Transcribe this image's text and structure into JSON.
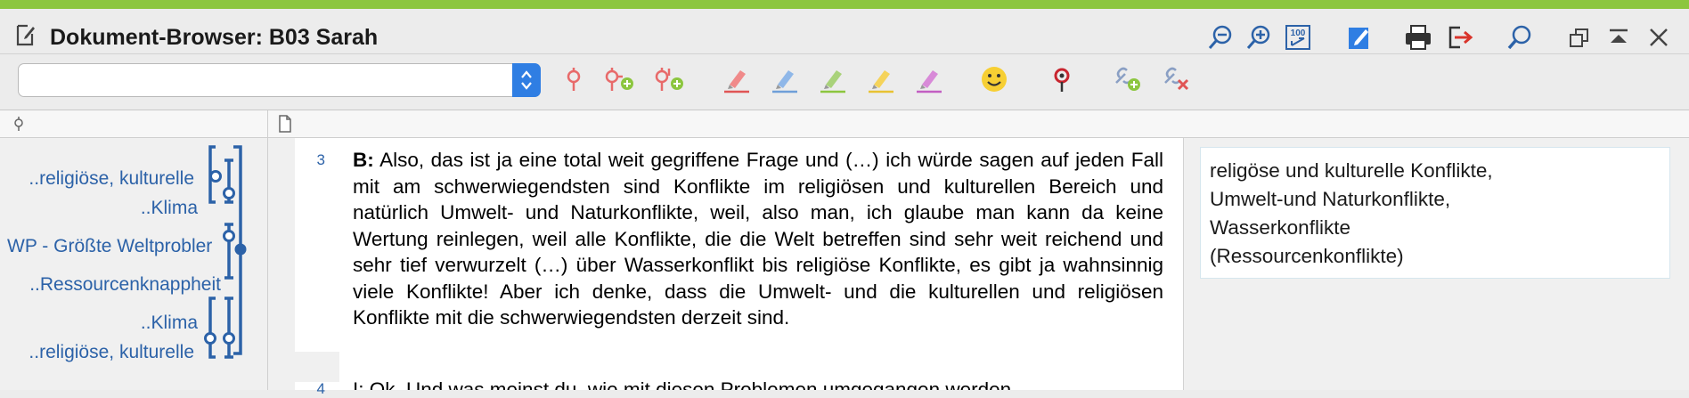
{
  "window": {
    "title": "Dokument-Browser: B03 Sarah",
    "accent_color": "#8cc63f",
    "title_icons": [
      "zoom-out-icon",
      "zoom-in-icon",
      "zoom-100-icon",
      "edit-icon",
      "print-icon",
      "export-icon",
      "search-icon",
      "restore-icon",
      "collapse-icon",
      "close-icon"
    ]
  },
  "toolbar": {
    "combo_value": "",
    "tool_icons": [
      "code-icon",
      "new-code-icon",
      "in-vivo-code-icon",
      "highlight-red-icon",
      "highlight-blue-icon",
      "highlight-green-icon",
      "highlight-yellow-icon",
      "highlight-magenta-icon",
      "emoticode-icon",
      "memo-pin-icon",
      "link-add-icon",
      "link-remove-icon"
    ]
  },
  "codes": [
    {
      "label": "..religiöse, kulturelle"
    },
    {
      "label": "..Klima"
    },
    {
      "label": "WP - Größte Weltprobler"
    },
    {
      "label": "..Ressourcenknappheit"
    },
    {
      "label": "..Klima"
    },
    {
      "label": "..religiöse, kulturelle"
    }
  ],
  "paragraph": {
    "line_number": "3",
    "speaker": "B:",
    "text": " Also, das ist ja eine total weit gegriffene Frage und (…) ich würde sagen auf jeden Fall mit am schwerwiegendsten sind Konflikte im religiösen und kulturellen Bereich und natürlich Umwelt- und Naturkonflikte, weil, also man, ich glaube man kann da keine Wertung reinlegen, weil alle Konflikte, die die Welt betreffen sind sehr weit reichend und sehr tief verwurzelt (…) über Wasserkonflikt bis religiöse Konflikte, es gibt ja wahnsinnig viele Konflikte! Aber ich denke, dass die Umwelt- und die kulturellen und religiösen Konflikte mit die schwerwiegendsten derzeit sind.",
    "next_line_number": "4",
    "next_text": "I: Ok. Und was meinst du, wie mit diesen Problemen umgegangen werden"
  },
  "memo": {
    "lines": [
      "religöse und kulturelle Konflikte,",
      "Umwelt-und Naturkonflikte,",
      "Wasserkonflikte",
      "(Ressourcenkonflikte)"
    ]
  },
  "colors": {
    "code_blue": "#2c62a8",
    "combo_blue": "#2f7ee3"
  }
}
